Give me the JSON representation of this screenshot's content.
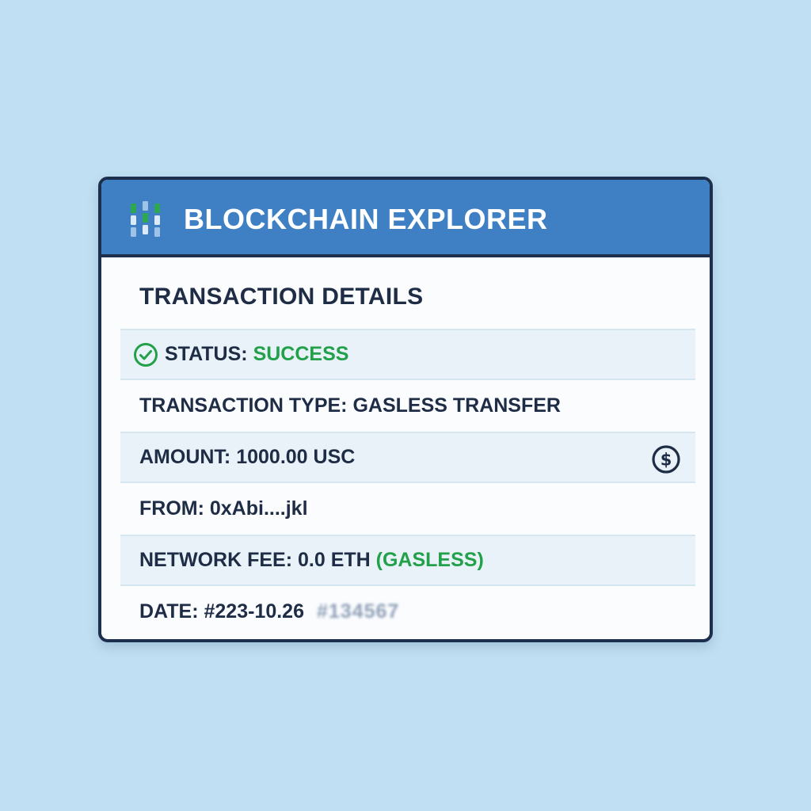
{
  "header": {
    "app_title": "BLOCKCHAIN EXPLORER",
    "logo_icon": "blockchain-cube-logo"
  },
  "main": {
    "section_title": "TRANSACTION DETAILS",
    "status": {
      "label": "STATUS:",
      "value": "SUCCESS",
      "icon": "check-circle-icon",
      "color": "#22a04a"
    },
    "transaction_type": {
      "label": "TRANSACTION TYPE:",
      "value": "GASLESS TRANSFER"
    },
    "amount": {
      "label": "AMOUNT:",
      "value": "1000.00 USC",
      "icon": "dollar-circle-icon"
    },
    "from": {
      "label": "FROM:",
      "value": "0xAbi....jkl"
    },
    "network_fee": {
      "label": "NETWORK FEE:",
      "value": "0.0 ETH",
      "note": "(GASLESS)",
      "note_color": "#22a04a"
    },
    "date": {
      "label": "DATE:",
      "value": "#223-10.26",
      "obscured": "#134567"
    }
  },
  "colors": {
    "background": "#c0dff2",
    "header": "#3f80c4",
    "border": "#1c2f4d",
    "text": "#1e2c45",
    "success": "#22a04a"
  }
}
